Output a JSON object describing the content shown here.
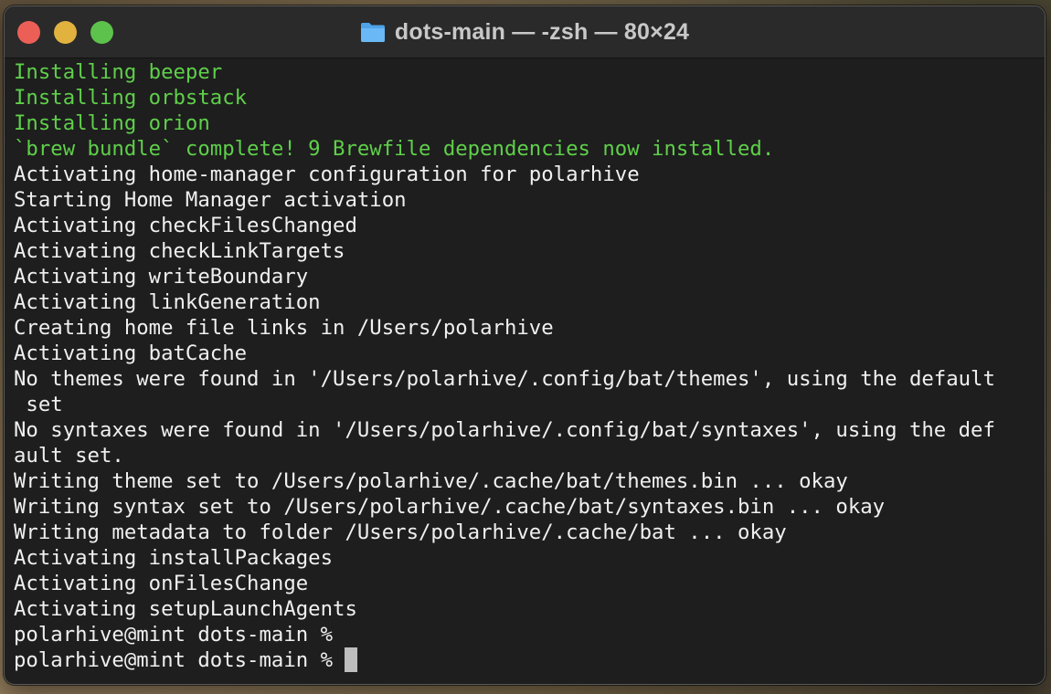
{
  "window": {
    "title": "dots-main — -zsh — 80×24",
    "title_icon": "folder-icon",
    "traffic_lights": {
      "close_color": "#ec5f57",
      "minimize_color": "#e2b23f",
      "maximize_color": "#5dc24c"
    }
  },
  "terminal": {
    "text_color": "#f0f0f0",
    "highlight_color": "#5fcf4a",
    "lines": [
      "Installing beeper",
      "Installing orbstack",
      "Installing orion",
      "`brew bundle` complete! 9 Brewfile dependencies now installed.",
      "Activating home-manager configuration for polarhive",
      "Starting Home Manager activation",
      "Activating checkFilesChanged",
      "Activating checkLinkTargets",
      "Activating writeBoundary",
      "Activating linkGeneration",
      "Creating home file links in /Users/polarhive",
      "Activating batCache",
      "No themes were found in '/Users/polarhive/.config/bat/themes', using the default",
      " set",
      "No syntaxes were found in '/Users/polarhive/.config/bat/syntaxes', using the def",
      "ault set.",
      "Writing theme set to /Users/polarhive/.cache/bat/themes.bin ... okay",
      "Writing syntax set to /Users/polarhive/.cache/bat/syntaxes.bin ... okay",
      "Writing metadata to folder /Users/polarhive/.cache/bat ... okay",
      "Activating installPackages",
      "Activating onFilesChange",
      "Activating setupLaunchAgents",
      "polarhive@mint dots-main % ",
      "polarhive@mint dots-main % "
    ]
  }
}
